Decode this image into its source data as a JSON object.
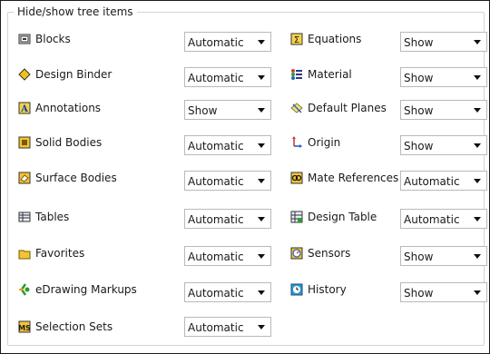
{
  "group": {
    "title": "Hide/show tree items"
  },
  "left": [
    {
      "icon": "blocks-icon",
      "label": "Blocks",
      "value": "Automatic"
    },
    {
      "icon": "design-binder-icon",
      "label": "Design Binder",
      "value": "Automatic"
    },
    {
      "icon": "annotations-icon",
      "label": "Annotations",
      "value": "Show"
    },
    {
      "icon": "solid-bodies-icon",
      "label": "Solid Bodies",
      "value": "Automatic"
    },
    {
      "icon": "surface-bodies-icon",
      "label": "Surface Bodies",
      "value": "Automatic"
    },
    {
      "icon": "tables-icon",
      "label": "Tables",
      "value": "Automatic"
    },
    {
      "icon": "favorites-icon",
      "label": "Favorites",
      "value": "Automatic"
    },
    {
      "icon": "edrawing-markups-icon",
      "label": "eDrawing Markups",
      "value": "Automatic"
    },
    {
      "icon": "selection-sets-icon",
      "label": "Selection Sets",
      "value": "Automatic"
    }
  ],
  "right": [
    {
      "icon": "equations-icon",
      "label": "Equations",
      "value": "Show"
    },
    {
      "icon": "material-icon",
      "label": "Material",
      "value": "Show"
    },
    {
      "icon": "default-planes-icon",
      "label": "Default Planes",
      "value": "Show"
    },
    {
      "icon": "origin-icon",
      "label": "Origin",
      "value": "Show"
    },
    {
      "icon": "mate-references-icon",
      "label": "Mate References",
      "value": "Automatic"
    },
    {
      "icon": "design-table-icon",
      "label": "Design Table",
      "value": "Automatic"
    },
    {
      "icon": "sensors-icon",
      "label": "Sensors",
      "value": "Show"
    },
    {
      "icon": "history-icon",
      "label": "History",
      "value": "Show"
    }
  ]
}
